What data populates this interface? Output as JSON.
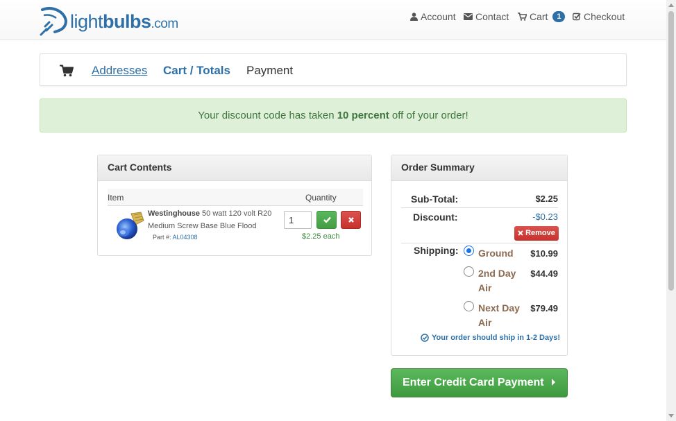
{
  "header": {
    "logo": {
      "part1": "light",
      "part2": "bulbs",
      "part3": ".com",
      "icon": "lightbulb-logo-icon"
    },
    "nav": [
      {
        "label": "Account",
        "icon": "user-icon"
      },
      {
        "label": "Contact",
        "icon": "envelope-icon"
      },
      {
        "label": "Cart",
        "icon": "cart-icon",
        "badge": "1"
      },
      {
        "label": "Checkout",
        "icon": "checkbox-icon"
      }
    ]
  },
  "breadcrumb": {
    "icon": "cart-icon",
    "steps": [
      "Addresses",
      "Cart / Totals",
      "Payment"
    ]
  },
  "alert": {
    "before": "Your discount code has taken ",
    "bold": "10 percent",
    "after": " off of your order!"
  },
  "cart": {
    "title": "Cart Contents",
    "col_item": "Item",
    "col_qty": "Quantity",
    "item": {
      "brand": "Westinghouse",
      "name": " 50 watt 120 volt R20 Medium Screw Base Blue Flood",
      "part_label": "Part #: ",
      "part_number": "AL04308",
      "quantity": "1",
      "price_each": "$2.25 each"
    }
  },
  "summary": {
    "title": "Order Summary",
    "subtotal_label": "Sub-Total:",
    "subtotal_value": "$2.25",
    "discount_label": "Discount:",
    "discount_value": "-$0.23",
    "remove_label": "Remove",
    "shipping_label": "Shipping:",
    "shipping_options": [
      {
        "name": "Ground",
        "price": "$10.99",
        "selected": true
      },
      {
        "name": "2nd Day Air",
        "price": "$44.49",
        "selected": false
      },
      {
        "name": "Next Day Air",
        "price": "$79.49",
        "selected": false
      }
    ],
    "ship_note": "Your order should ship in 1-2 Days!"
  },
  "cta": {
    "label": "Enter Credit Card Payment"
  },
  "colors": {
    "brand": "#2d6fa6",
    "success": "#5cb85c",
    "danger": "#d9534f",
    "alert_bg": "#dff0d8",
    "shipping_text": "#8b6a4f"
  }
}
